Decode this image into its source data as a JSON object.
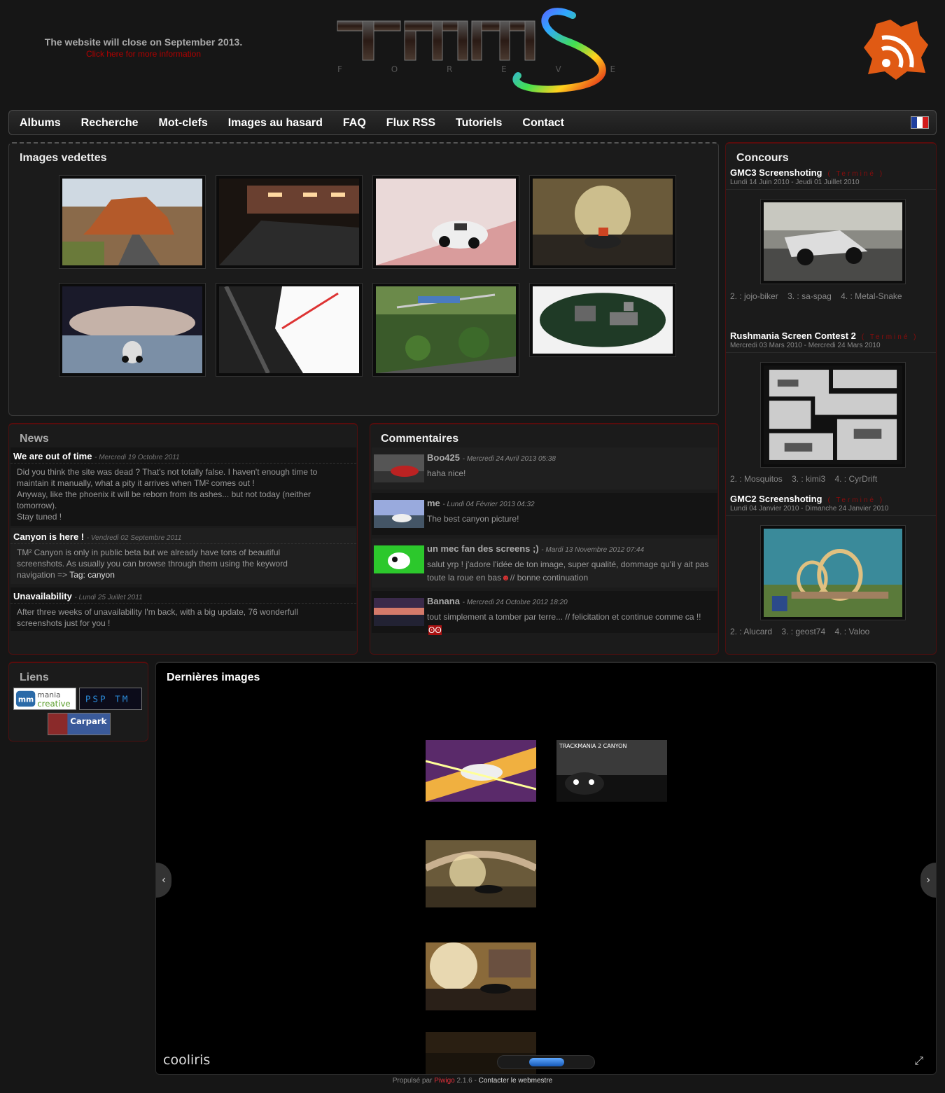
{
  "header": {
    "notice_line1": "The website will close on September 2013.",
    "notice_line2": "Click here for more information",
    "logo_letters": "TMMS",
    "logo_sub": "F O R E V E R"
  },
  "menu": {
    "items": [
      "Albums",
      "Recherche",
      "Mot-clefs",
      "Images au hasard",
      "FAQ",
      "Flux RSS",
      "Tutoriels",
      "Contact"
    ]
  },
  "featured": {
    "title": "Images vedettes"
  },
  "concours": {
    "title": "Concours",
    "contests": [
      {
        "name": "GMC3 Screenshoting",
        "status": "( Terminé )",
        "dates": "Lundi 14 Juin 2010 - Jeudi 01 Juillet 2010",
        "ranks": [
          {
            "pos": "2. :",
            "name": "jojo-biker"
          },
          {
            "pos": "3. :",
            "name": "sa-spag"
          },
          {
            "pos": "4. :",
            "name": "Metal-Snake"
          }
        ]
      },
      {
        "name": "Rushmania Screen Contest 2",
        "status": "( Terminé )",
        "dates": "Mercredi 03 Mars 2010 - Mercredi 24 Mars 2010",
        "ranks": [
          {
            "pos": "2. :",
            "name": "Mosquitos"
          },
          {
            "pos": "3. :",
            "name": "kimi3"
          },
          {
            "pos": "4. :",
            "name": "CyrDrift"
          }
        ]
      },
      {
        "name": "GMC2 Screenshoting",
        "status": "( Terminé )",
        "dates": "Lundi 04 Janvier 2010 - Dimanche 24 Janvier 2010",
        "ranks": [
          {
            "pos": "2. :",
            "name": "Alucard"
          },
          {
            "pos": "3. :",
            "name": "geost74"
          },
          {
            "pos": "4. :",
            "name": "Valoo"
          }
        ]
      }
    ]
  },
  "news": {
    "title": "News",
    "items": [
      {
        "title": "We are out of time",
        "date": "Mercredi 19 Octobre 2011",
        "body": [
          "Did you think the site was dead ? That's not totally false. I haven't enough time to",
          "maintain it manually, what a pity it arrives when TM² comes out !",
          "Anyway, like the phoenix it will be reborn from its ashes... but not today (neither",
          "tomorrow).",
          "Stay tuned !"
        ]
      },
      {
        "title": "Canyon is here !",
        "date": "Vendredi 02 Septembre 2011",
        "body": [
          "TM² Canyon is only in public beta but we already have tons of beautiful",
          "screenshots. As usually you can browse through them using the keyword"
        ],
        "body_last": "navigation => ",
        "tag": "Tag: canyon"
      },
      {
        "title": "Unavailability",
        "date": "Lundi 25 Juillet 2011",
        "body": [
          "After three weeks of unavailability I'm back, with a big update, 76 wonderfull",
          "screenshots just for you !"
        ]
      }
    ]
  },
  "comments": {
    "title": "Commentaires",
    "items": [
      {
        "author": "Boo425",
        "date": "Mercredi 24 Avril 2013 05:38",
        "text": "haha nice!"
      },
      {
        "author": "me",
        "date": "Lundi 04 Février 2013 04:32",
        "text": "The best canyon picture!"
      },
      {
        "author": "un mec fan des screens ;)",
        "date": "Mardi 13 Novembre 2012 07:44",
        "text": "salut yrp ! j'adore l'idée de ton image, super qualité, dommage qu'il y ait pas",
        "text2": "toute la roue en bas",
        "text3": "// bonne continuation"
      },
      {
        "author": "Banana",
        "date": "Mercredi 24 Octobre 2012 18:20",
        "text": "tout simplement a tomber par terre... // felicitation et continue comme ca !!"
      }
    ]
  },
  "liens": {
    "title": "Liens",
    "links": [
      "mania creative",
      "PSP TM",
      "Carpark"
    ]
  },
  "dernieres": {
    "title": "Dernières images",
    "brand": "cooliris",
    "thumb_caption": "TRACKMANIA 2 CANYON"
  },
  "footer": {
    "prefix": "Propulsé par",
    "piwigo": "Piwigo",
    "version": "2.1.6 -",
    "contact": "Contacter le webmestre"
  },
  "colors": {
    "accent_red": "#b20000",
    "bg": "#161616",
    "status_red": "#8a0c0c"
  }
}
